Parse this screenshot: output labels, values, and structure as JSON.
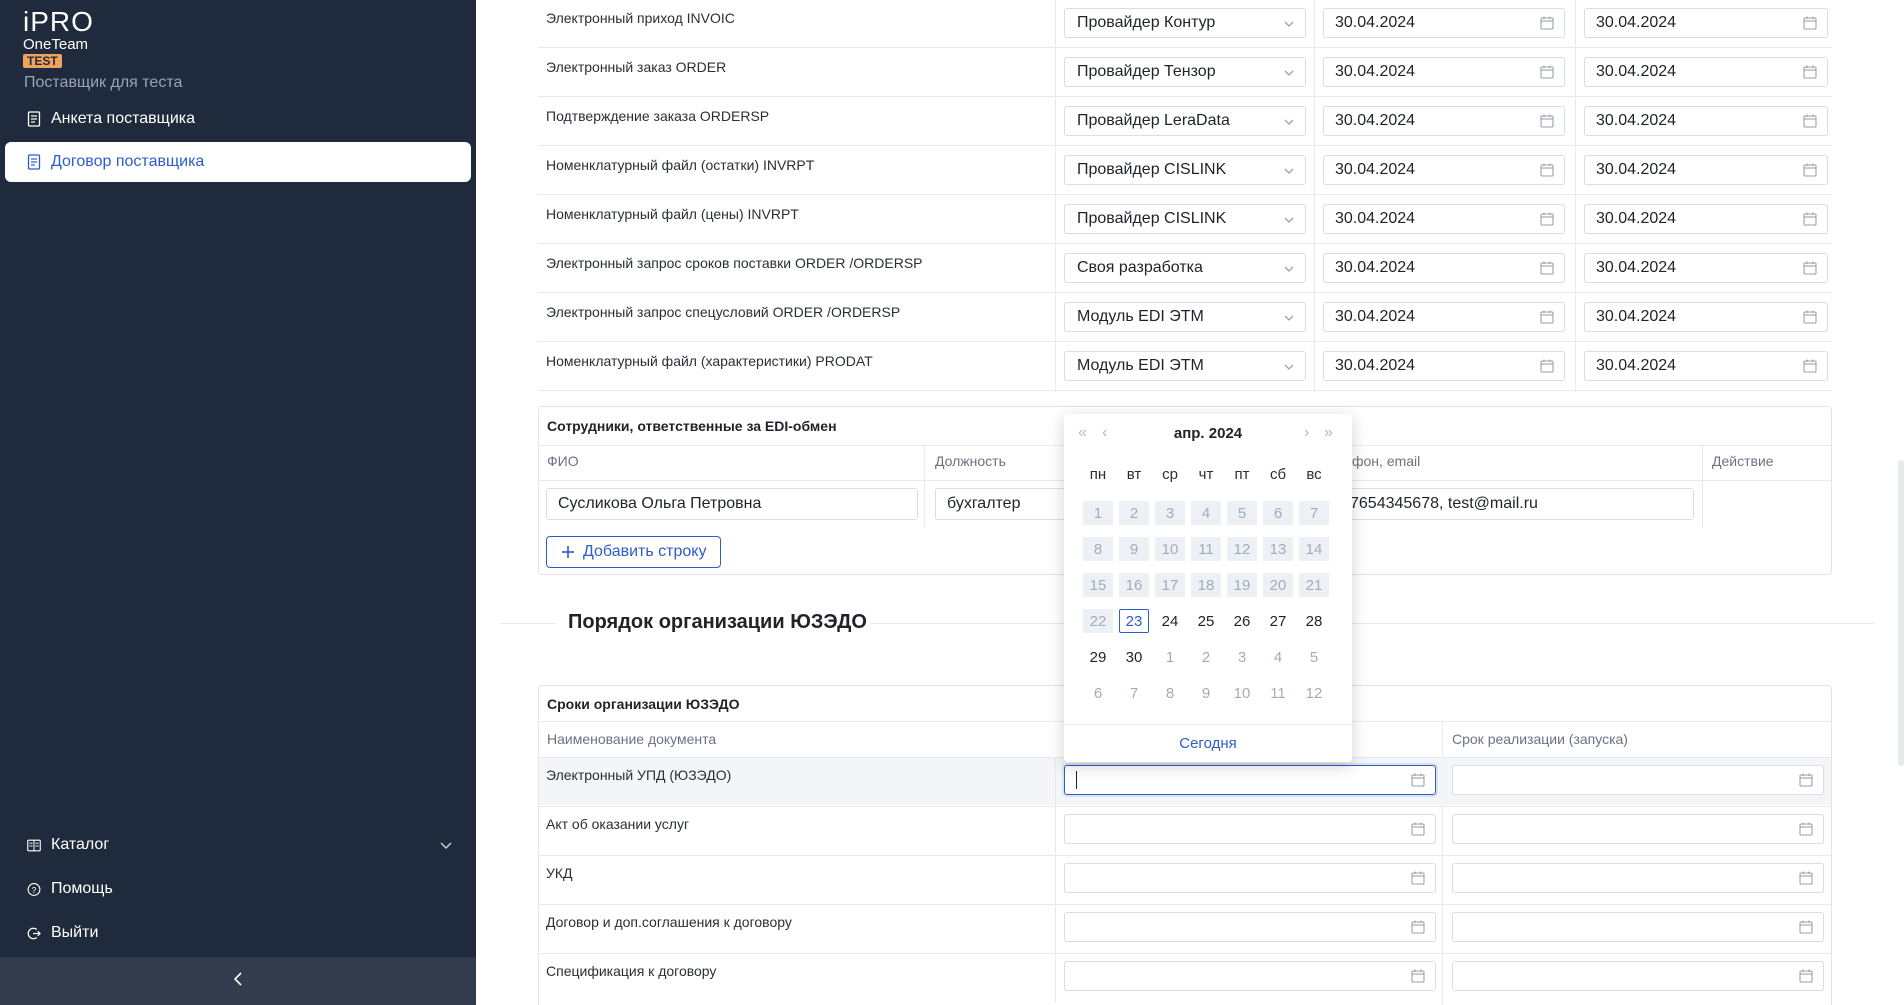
{
  "sidebar": {
    "logo_line1": "iPRO",
    "logo_line2": "OneTeam",
    "logo_badge": "TEST",
    "supplier_name": "Поставщик для теста",
    "items": [
      {
        "label": "Анкета поставщика",
        "icon": "document-icon"
      },
      {
        "label": "Договор поставщика",
        "icon": "document-icon",
        "active": true
      }
    ],
    "bottom_items": [
      {
        "label": "Каталог",
        "icon": "catalog-icon"
      },
      {
        "label": "Помощь",
        "icon": "help-icon"
      },
      {
        "label": "Выйти",
        "icon": "logout-icon"
      }
    ]
  },
  "edi_rows": [
    {
      "label": "Электронный приход INVOIC",
      "provider": "Провайдер Контур",
      "date_from": "30.04.2024",
      "date_to": "30.04.2024"
    },
    {
      "label": "Электронный заказ ORDER",
      "provider": "Провайдер Тензор",
      "date_from": "30.04.2024",
      "date_to": "30.04.2024"
    },
    {
      "label": "Подтверждение заказа ORDERSP",
      "provider": "Провайдер LeraData",
      "date_from": "30.04.2024",
      "date_to": "30.04.2024"
    },
    {
      "label": "Номенклатурный файл (остатки) INVRPT",
      "provider": "Провайдер CISLINK",
      "date_from": "30.04.2024",
      "date_to": "30.04.2024"
    },
    {
      "label": "Номенклатурный файл (цены) INVRPT",
      "provider": "Провайдер CISLINK",
      "date_from": "30.04.2024",
      "date_to": "30.04.2024"
    },
    {
      "label": "Электронный запрос сроков поставки ORDER /ORDERSP",
      "provider": "Своя разработка",
      "date_from": "30.04.2024",
      "date_to": "30.04.2024"
    },
    {
      "label": "Электронный запрос спецусловий ORDER /ORDERSP",
      "provider": "Модуль EDI ЭТМ",
      "date_from": "30.04.2024",
      "date_to": "30.04.2024"
    },
    {
      "label": "Номенклатурный файл (характеристики) PRODAT",
      "provider": "Модуль EDI ЭТМ",
      "date_from": "30.04.2024",
      "date_to": "30.04.2024"
    }
  ],
  "employees": {
    "title": "Сотрудники, ответственные за EDI-обмен",
    "col_name": "ФИО",
    "col_position": "Должность",
    "col_contacts": "фон, email",
    "col_action": "Действие",
    "row": {
      "name": "Сусликова Ольга Петровна",
      "position": "бухгалтер",
      "contacts": "7654345678, test@mail.ru"
    },
    "add_button": "Добавить строку"
  },
  "uzedo": {
    "section_title": "Порядок организации ЮЗЭДО",
    "panel_title": "Сроки организации ЮЗЭДО",
    "col_doc": "Наименование документа",
    "col_term": "Срок реализации (запуска)",
    "rows": [
      "Электронный УПД (ЮЗЭДО)",
      "Акт об оказании услуг",
      "УКД",
      "Договор и доп.соглашения к договору",
      "Спецификация к договору"
    ]
  },
  "calendar": {
    "month": "апр.",
    "year": "2024",
    "weekdays": [
      "пн",
      "вт",
      "ср",
      "чт",
      "пт",
      "сб",
      "вс"
    ],
    "weeks": [
      [
        [
          "1",
          "d"
        ],
        [
          "2",
          "d"
        ],
        [
          "3",
          "d"
        ],
        [
          "4",
          "d"
        ],
        [
          "5",
          "d"
        ],
        [
          "6",
          "d"
        ],
        [
          "7",
          "d"
        ]
      ],
      [
        [
          "8",
          "d"
        ],
        [
          "9",
          "d"
        ],
        [
          "10",
          "d"
        ],
        [
          "11",
          "d"
        ],
        [
          "12",
          "d"
        ],
        [
          "13",
          "d"
        ],
        [
          "14",
          "d"
        ]
      ],
      [
        [
          "15",
          "d"
        ],
        [
          "16",
          "d"
        ],
        [
          "17",
          "d"
        ],
        [
          "18",
          "d"
        ],
        [
          "19",
          "d"
        ],
        [
          "20",
          "d"
        ],
        [
          "21",
          "d"
        ]
      ],
      [
        [
          "22",
          "d"
        ],
        [
          "23",
          "t"
        ],
        [
          "24",
          "n"
        ],
        [
          "25",
          "n"
        ],
        [
          "26",
          "n"
        ],
        [
          "27",
          "n"
        ],
        [
          "28",
          "n"
        ]
      ],
      [
        [
          "29",
          "n"
        ],
        [
          "30",
          "n"
        ],
        [
          "1",
          "o"
        ],
        [
          "2",
          "o"
        ],
        [
          "3",
          "o"
        ],
        [
          "4",
          "o"
        ],
        [
          "5",
          "o"
        ]
      ],
      [
        [
          "6",
          "o"
        ],
        [
          "7",
          "o"
        ],
        [
          "8",
          "o"
        ],
        [
          "9",
          "o"
        ],
        [
          "10",
          "o"
        ],
        [
          "11",
          "o"
        ],
        [
          "12",
          "o"
        ]
      ]
    ],
    "today_label": "Сегодня"
  },
  "colors": {
    "sidebar_bg": "#1f2a3c",
    "accent": "#2b5ec9",
    "badge": "#f0a35c"
  }
}
